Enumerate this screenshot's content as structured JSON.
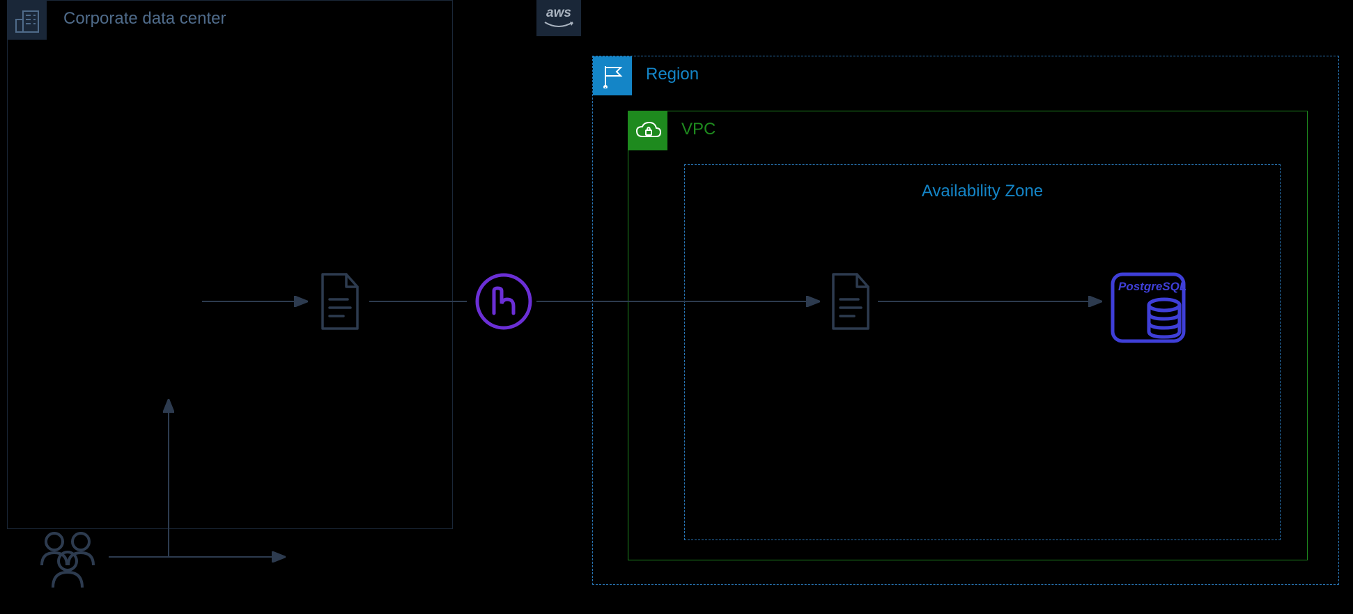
{
  "corporate": {
    "label": "Corporate data center"
  },
  "aws": {
    "label": "aws"
  },
  "region": {
    "label": "Region"
  },
  "vpc": {
    "label": "VPC"
  },
  "az": {
    "label": "Availability Zone"
  },
  "postgres": {
    "label": "PostgreSQL"
  },
  "icons": {
    "building": "building-icon",
    "flag": "flag-icon",
    "cloud_lock": "cloud-lock-icon",
    "file": "file-icon",
    "users": "users-icon",
    "hex": "hex-n-icon",
    "postgres": "postgres-icon",
    "aws": "aws-logo-icon"
  },
  "colors": {
    "bg": "#000000",
    "corp_border": "#1a2738",
    "region_blue": "#1485c7",
    "vpc_green": "#1e8a1e",
    "dashed_blue": "#2876b6",
    "arrow": "#2d3b4f",
    "hex_purple": "#6b2fd6",
    "pg_blue": "#3f3fd8"
  }
}
